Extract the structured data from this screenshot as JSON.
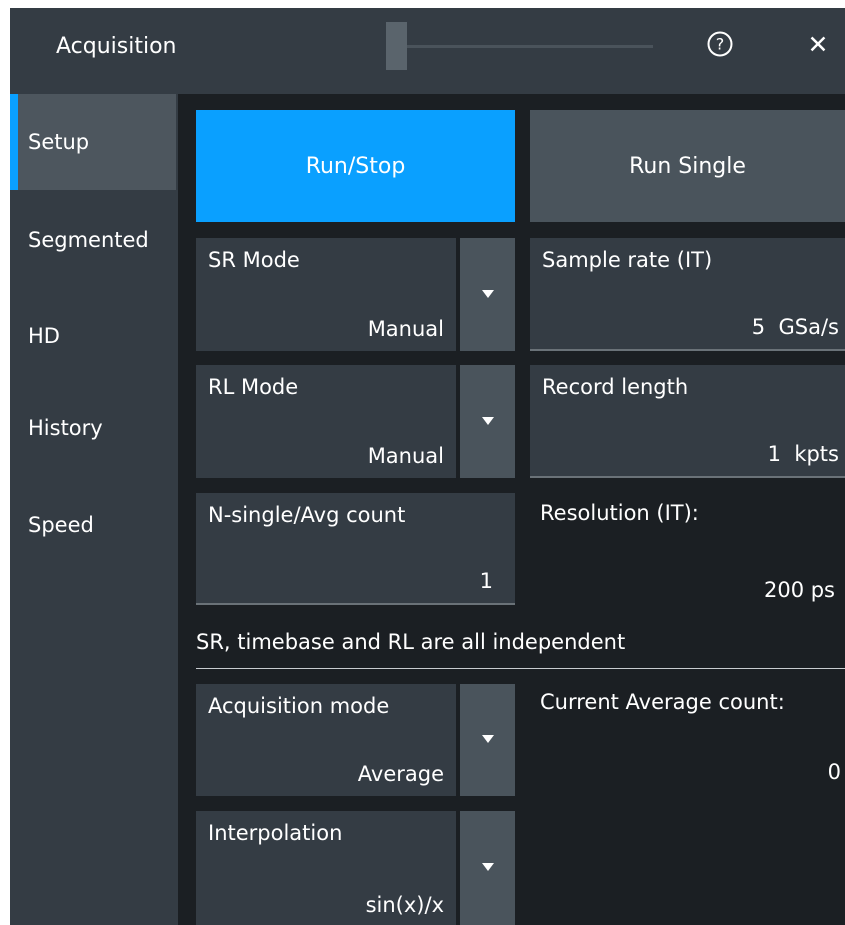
{
  "window": {
    "title": "Acquisition",
    "help_glyph": "?",
    "close_glyph": "✕"
  },
  "sidebar": {
    "items": [
      {
        "label": "Setup",
        "active": true
      },
      {
        "label": "Segmented"
      },
      {
        "label": "HD"
      },
      {
        "label": "History"
      },
      {
        "label": "Speed"
      }
    ]
  },
  "buttons": {
    "run_stop": "Run/Stop",
    "run_single": "Run Single"
  },
  "fields": {
    "sr_mode": {
      "label": "SR Mode",
      "value": "Manual"
    },
    "sample_rate": {
      "label": "Sample rate (IT)",
      "value": "5  GSa/s"
    },
    "rl_mode": {
      "label": "RL Mode",
      "value": "Manual"
    },
    "record_length": {
      "label": "Record length",
      "value": "1  kpts"
    },
    "n_single": {
      "label": "N-single/Avg count",
      "value": "1"
    },
    "resolution": {
      "label": "Resolution (IT):",
      "value": "200 ps"
    },
    "acquisition_mode": {
      "label": "Acquisition mode",
      "value": "Average"
    },
    "current_avg": {
      "label": "Current Average count:",
      "value": "0"
    },
    "interpolation": {
      "label": "Interpolation",
      "value": "sin(x)/x"
    }
  },
  "info_text": "SR, timebase and RL are all independent",
  "colors": {
    "accent": "#0aa0ff",
    "panel": "#343c44",
    "background": "#1b1f23"
  }
}
